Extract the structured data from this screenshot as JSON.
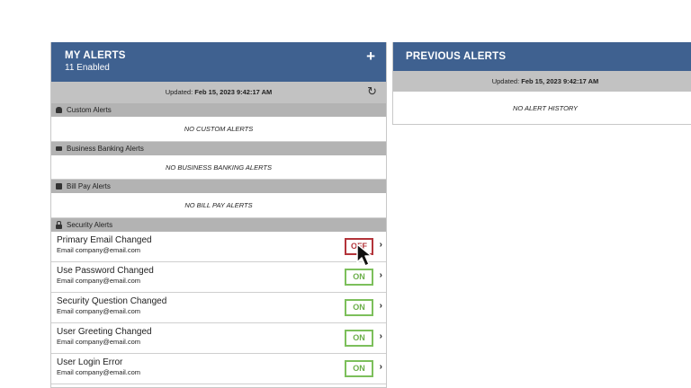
{
  "my_alerts": {
    "title": "MY ALERTS",
    "subtitle": "11 Enabled",
    "add_icon": "+",
    "updated_label": "Updated: ",
    "updated_value": "Feb 15, 2023 9:42:17 AM",
    "refresh_icon": "↻",
    "sections": {
      "custom": {
        "title": "Custom Alerts",
        "empty": "NO CUSTOM ALERTS"
      },
      "business": {
        "title": "Business Banking Alerts",
        "empty": "NO BUSINESS BANKING ALERTS"
      },
      "billpay": {
        "title": "Bill Pay Alerts",
        "empty": "NO BILL PAY ALERTS"
      },
      "security": {
        "title": "Security Alerts",
        "items": [
          {
            "name": "Primary Email Changed",
            "email": "Email company@email.com",
            "status": "OFF"
          },
          {
            "name": "Use Password Changed",
            "email": "Email company@email.com",
            "status": "ON"
          },
          {
            "name": "Security Question Changed",
            "email": "Email company@email.com",
            "status": "ON"
          },
          {
            "name": "User Greeting Changed",
            "email": "Email company@email.com",
            "status": "ON"
          },
          {
            "name": "User Login Error",
            "email": "Email company@email.com",
            "status": "ON"
          }
        ]
      }
    },
    "chevron": "›"
  },
  "previous_alerts": {
    "title": "PREVIOUS ALERTS",
    "updated_label": "Updated: ",
    "updated_value": "Feb 15, 2023 9:42:17 AM",
    "empty": "NO ALERT HISTORY"
  },
  "colors": {
    "header": "#3f6190",
    "on": "#7cbf5b",
    "off": "#b3343a"
  }
}
